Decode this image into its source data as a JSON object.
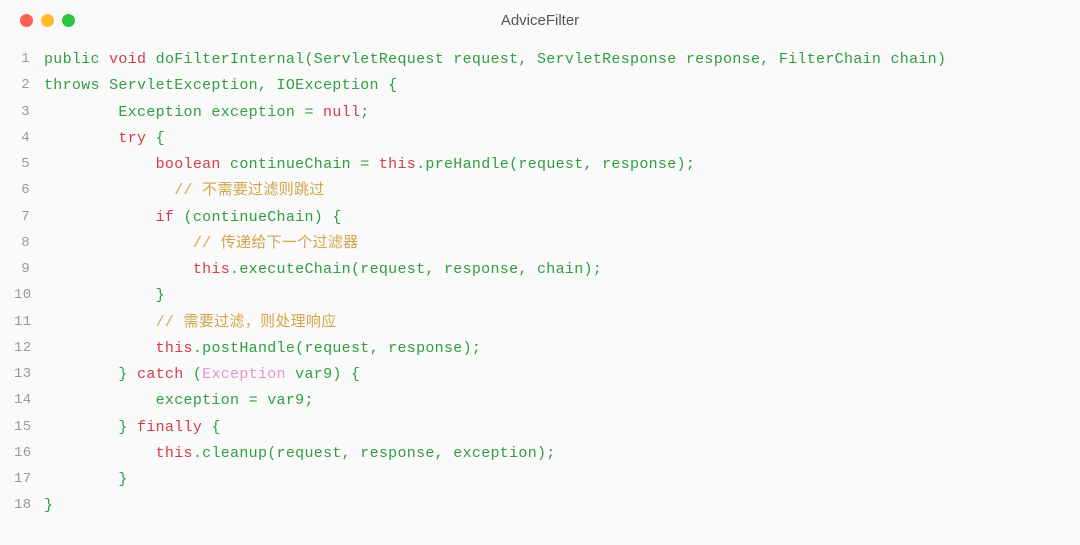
{
  "window": {
    "title": "AdviceFilter"
  },
  "code": {
    "lines": [
      {
        "n": "1",
        "tokens": [
          {
            "c": "kw-green",
            "t": "public "
          },
          {
            "c": "kw-redbold",
            "t": "void"
          },
          {
            "c": "plain",
            "t": " doFilterInternal(ServletRequest request, ServletResponse response, FilterChain chain)"
          }
        ]
      },
      {
        "n": "2",
        "tokens": [
          {
            "c": "kw-green",
            "t": "throws"
          },
          {
            "c": "plain",
            "t": " ServletException, IOException {"
          }
        ]
      },
      {
        "n": "3",
        "tokens": [
          {
            "c": "plain",
            "t": "        Exception exception = "
          },
          {
            "c": "kw-red",
            "t": "null"
          },
          {
            "c": "plain",
            "t": ";"
          }
        ]
      },
      {
        "n": "4",
        "tokens": [
          {
            "c": "plain",
            "t": "        "
          },
          {
            "c": "kw-red",
            "t": "try"
          },
          {
            "c": "plain",
            "t": " {"
          }
        ]
      },
      {
        "n": "5",
        "tokens": [
          {
            "c": "plain",
            "t": "            "
          },
          {
            "c": "kw-red",
            "t": "boolean"
          },
          {
            "c": "plain",
            "t": " continueChain = "
          },
          {
            "c": "kw-red",
            "t": "this"
          },
          {
            "c": "plain",
            "t": ".preHandle(request, response);"
          }
        ]
      },
      {
        "n": "6",
        "tokens": [
          {
            "c": "plain",
            "t": "              "
          },
          {
            "c": "comment",
            "t": "// 不需要过滤则跳过"
          }
        ]
      },
      {
        "n": "7",
        "tokens": [
          {
            "c": "plain",
            "t": "            "
          },
          {
            "c": "kw-red",
            "t": "if"
          },
          {
            "c": "plain",
            "t": " (continueChain) {"
          }
        ]
      },
      {
        "n": "8",
        "tokens": [
          {
            "c": "plain",
            "t": "                "
          },
          {
            "c": "comment",
            "t": "// 传递给下一个过滤器"
          }
        ]
      },
      {
        "n": "9",
        "tokens": [
          {
            "c": "plain",
            "t": "                "
          },
          {
            "c": "kw-red",
            "t": "this"
          },
          {
            "c": "plain",
            "t": ".executeChain(request, response, chain);"
          }
        ]
      },
      {
        "n": "10",
        "tokens": [
          {
            "c": "plain",
            "t": "            }"
          }
        ]
      },
      {
        "n": "11",
        "tokens": [
          {
            "c": "plain",
            "t": "            "
          },
          {
            "c": "comment",
            "t": "// 需要过滤，则处理响应"
          }
        ]
      },
      {
        "n": "12",
        "tokens": [
          {
            "c": "plain",
            "t": "            "
          },
          {
            "c": "kw-red",
            "t": "this"
          },
          {
            "c": "plain",
            "t": ".postHandle(request, response);"
          }
        ]
      },
      {
        "n": "13",
        "tokens": [
          {
            "c": "plain",
            "t": "        } "
          },
          {
            "c": "kw-red",
            "t": "catch"
          },
          {
            "c": "plain",
            "t": " ("
          },
          {
            "c": "pink",
            "t": "Exception"
          },
          {
            "c": "plain",
            "t": " var9) {"
          }
        ]
      },
      {
        "n": "14",
        "tokens": [
          {
            "c": "plain",
            "t": "            exception = var9;"
          }
        ]
      },
      {
        "n": "15",
        "tokens": [
          {
            "c": "plain",
            "t": "        } "
          },
          {
            "c": "kw-red",
            "t": "finally"
          },
          {
            "c": "plain",
            "t": " {"
          }
        ]
      },
      {
        "n": "16",
        "tokens": [
          {
            "c": "plain",
            "t": "            "
          },
          {
            "c": "kw-red",
            "t": "this"
          },
          {
            "c": "plain",
            "t": ".cleanup(request, response, exception);"
          }
        ]
      },
      {
        "n": "17",
        "tokens": [
          {
            "c": "plain",
            "t": "        }"
          }
        ]
      },
      {
        "n": "18",
        "tokens": [
          {
            "c": "plain",
            "t": "}"
          }
        ]
      }
    ]
  }
}
